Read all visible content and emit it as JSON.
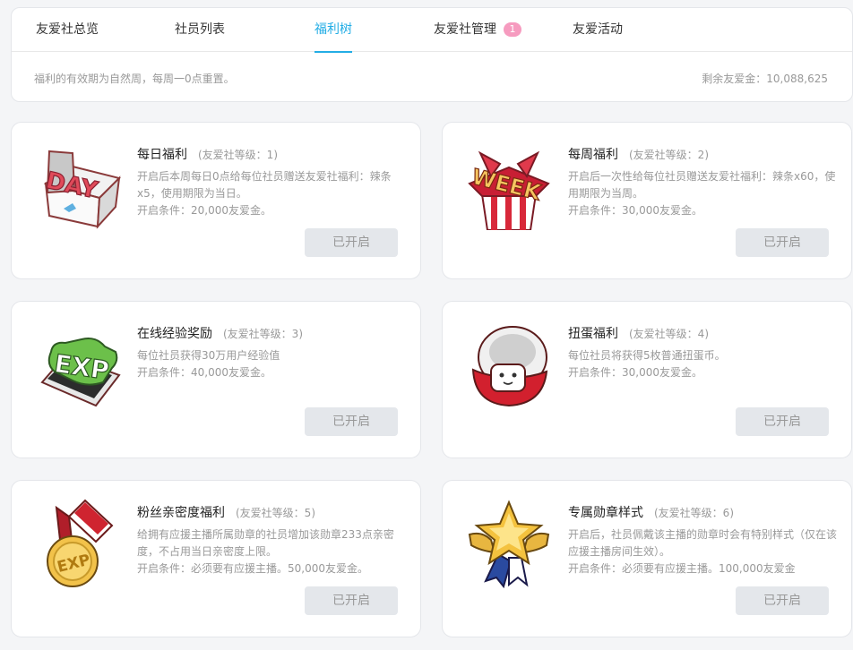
{
  "tabs": [
    {
      "label": "友爱社总览"
    },
    {
      "label": "社员列表"
    },
    {
      "label": "福利树"
    },
    {
      "label": "友爱社管理",
      "badge": "1"
    },
    {
      "label": "友爱活动"
    }
  ],
  "notice": "福利的有效期为自然周，每周一0点重置。",
  "balance": "剩余友爱金：10,088,625",
  "colors": {
    "accent": "#23ade5",
    "badge": "#f69bbf",
    "button_bg": "#e4e7eb"
  },
  "cards": [
    {
      "title": "每日福利",
      "level": "(友爱社等级：1)",
      "icon": "day-box-icon",
      "desc": [
        "开启后本周每日0点给每位社员赠送友爱社福利：辣条x5，使用期限为当日。",
        "开启条件：20,000友爱金。"
      ],
      "button": "已开启"
    },
    {
      "title": "每周福利",
      "level": "(友爱社等级：2)",
      "icon": "week-box-icon",
      "desc": [
        "开启后一次性给每位社员赠送友爱社福利：辣条x60，使用期限为当周。",
        "开启条件：30,000友爱金。"
      ],
      "button": "已开启"
    },
    {
      "title": "在线经验奖励",
      "level": "(友爱社等级：3)",
      "icon": "exp-screen-icon",
      "desc": [
        "每位社员获得30万用户经验值",
        "开启条件：40,000友爱金。"
      ],
      "button": "已开启"
    },
    {
      "title": "扭蛋福利",
      "level": "(友爱社等级：4)",
      "icon": "gacha-capsule-icon",
      "desc": [
        "每位社员将获得5枚普通扭蛋币。",
        "开启条件：30,000友爱金。"
      ],
      "button": "已开启"
    },
    {
      "title": "粉丝亲密度福利",
      "level": "(友爱社等级：5)",
      "icon": "exp-medal-icon",
      "desc": [
        "给拥有应援主播所属勋章的社员增加该勋章233点亲密度，不占用当日亲密度上限。",
        "开启条件：必须要有应援主播。50,000友爱金。"
      ],
      "button": "已开启"
    },
    {
      "title": "专属勋章样式",
      "level": "(友爱社等级：6)",
      "icon": "star-badge-icon",
      "desc": [
        "开启后，社员佩戴该主播的勋章时会有特别样式（仅在该应援主播房间生效）。",
        "开启条件：必须要有应援主播。100,000友爱金"
      ],
      "button": "已开启"
    }
  ]
}
